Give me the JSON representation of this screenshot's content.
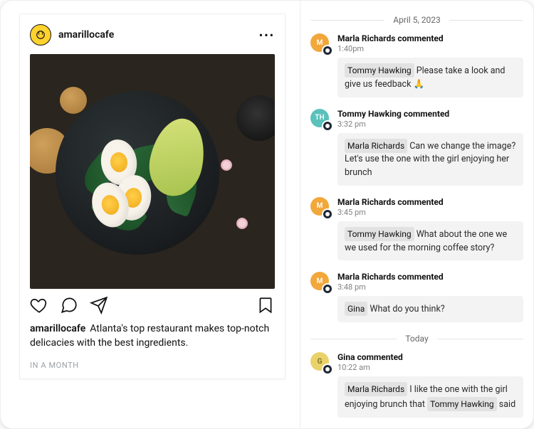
{
  "post": {
    "username": "amarillocafe",
    "caption_user": "amarillocafe",
    "caption_text": "Atlanta's top restaurant makes top-notch delicacies with the best ingredients.",
    "schedule": "IN A MONTH"
  },
  "icons": {
    "more": "•••"
  },
  "thread": {
    "dividers": {
      "date1": "April 5, 2023",
      "date2": "Today"
    },
    "comments": [
      {
        "avatar_initials": "M",
        "avatar_color": "orange",
        "head": "Marla Richards commented",
        "time": "1:40pm",
        "segments": [
          {
            "type": "mention",
            "text": "Tommy Hawking"
          },
          {
            "type": "text",
            "text": " Please take a look and give us feedback 🙏"
          }
        ]
      },
      {
        "avatar_initials": "TH",
        "avatar_color": "teal",
        "head": "Tommy Hawking commented",
        "time": "3:32 pm",
        "segments": [
          {
            "type": "mention",
            "text": "Marla Richards"
          },
          {
            "type": "text",
            "text": " Can we change the image? Let's use the one with the girl enjoying her brunch"
          }
        ]
      },
      {
        "avatar_initials": "M",
        "avatar_color": "orange",
        "head": "Marla Richards commented",
        "time": "3:45 pm",
        "segments": [
          {
            "type": "mention",
            "text": "Tommy Hawking"
          },
          {
            "type": "text",
            "text": " What about the one we we used for the morning coffee story?"
          }
        ]
      },
      {
        "avatar_initials": "M",
        "avatar_color": "orange",
        "head": "Marla Richards commented",
        "time": "3:48 pm",
        "segments": [
          {
            "type": "mention",
            "text": "Gina"
          },
          {
            "type": "text",
            "text": " What do you think?"
          }
        ]
      },
      {
        "avatar_initials": "G",
        "avatar_color": "yellow",
        "head": "Gina commented",
        "time": "10:22 am",
        "segments": [
          {
            "type": "mention",
            "text": "Marla Richards"
          },
          {
            "type": "text",
            "text": " I like the one with the girl enjoying brunch that "
          },
          {
            "type": "mention",
            "text": "Tommy Hawking"
          },
          {
            "type": "text",
            "text": " said"
          }
        ]
      }
    ]
  }
}
